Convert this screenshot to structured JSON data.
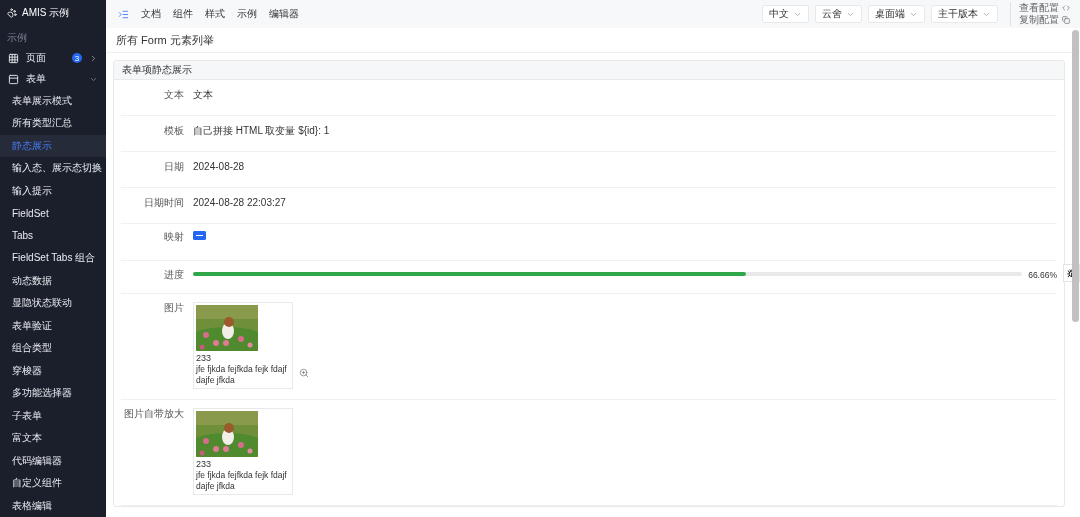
{
  "brand": {
    "title": "AMIS 示例"
  },
  "sidebar": {
    "group_label": "示例",
    "items": [
      {
        "label": "页面",
        "badge": "3",
        "expanded": false
      },
      {
        "label": "表单",
        "expanded": true,
        "children": [
          {
            "label": "表单展示模式",
            "selected": false
          },
          {
            "label": "所有类型汇总",
            "selected": false
          },
          {
            "label": "静态展示",
            "selected": true
          },
          {
            "label": "输入态、展示态切换",
            "selected": false
          },
          {
            "label": "输入提示",
            "selected": false
          },
          {
            "label": "FieldSet",
            "selected": false
          },
          {
            "label": "Tabs",
            "selected": false
          },
          {
            "label": "FieldSet Tabs 组合",
            "selected": false
          },
          {
            "label": "动态数据",
            "selected": false
          },
          {
            "label": "显隐状态联动",
            "selected": false
          },
          {
            "label": "表单验证",
            "selected": false
          },
          {
            "label": "组合类型",
            "selected": false
          },
          {
            "label": "穿梭器",
            "selected": false
          },
          {
            "label": "多功能选择器",
            "selected": false
          },
          {
            "label": "子表单",
            "selected": false
          },
          {
            "label": "富文本",
            "selected": false
          },
          {
            "label": "代码编辑器",
            "selected": false
          },
          {
            "label": "自定义组件",
            "selected": false
          },
          {
            "label": "表格编辑",
            "selected": false
          }
        ]
      }
    ]
  },
  "topnav": {
    "links": [
      "文档",
      "组件",
      "样式",
      "示例",
      "编辑器"
    ],
    "dropdowns": [
      "中文",
      "云舍",
      "桌面端",
      "主干版本"
    ],
    "config_links": [
      "查看配置",
      "复制配置"
    ]
  },
  "page": {
    "title": "所有 Form 元素列举"
  },
  "panel": {
    "title": "表单项静态展示",
    "fields": [
      {
        "label": "文本",
        "kind": "text",
        "value": "文本"
      },
      {
        "label": "模板",
        "kind": "text",
        "value": "自己拼接 HTML 取变量 ${id}: 1"
      },
      {
        "label": "日期",
        "kind": "text",
        "value": "2024-08-28"
      },
      {
        "label": "日期时间",
        "kind": "text",
        "value": "2024-08-28 22:03:27"
      },
      {
        "label": "映射",
        "kind": "mapping"
      },
      {
        "label": "进度",
        "kind": "progress",
        "level": 0.6666,
        "reading": "66.66%"
      },
      {
        "label": "图片",
        "title": "233",
        "caption": "jfe fjkda fejfkda fejk fdajf dajfe jfkda",
        "zoom_button": true
      },
      {
        "label": "图片自带放大",
        "title": "233",
        "caption": "jfe fjkda fejfkda fejk fdajf dajfe jfkda",
        "zoom_button": false
      }
    ]
  }
}
